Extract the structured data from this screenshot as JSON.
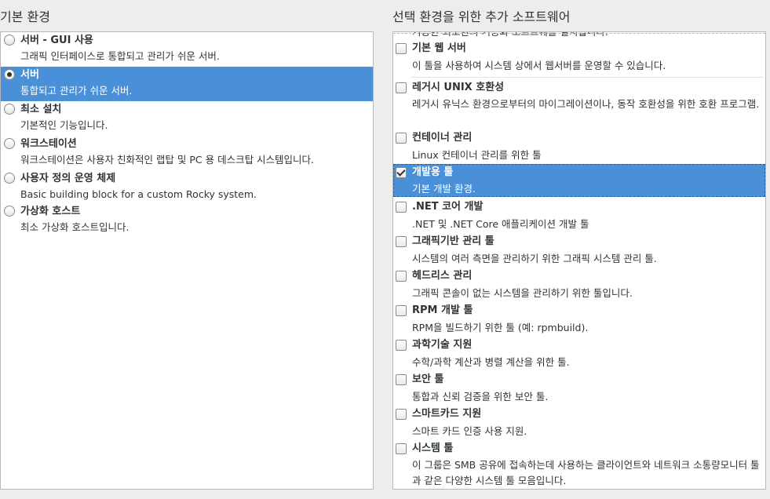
{
  "left": {
    "title": "기본 환경",
    "items": [
      {
        "title": "서버 - GUI 사용",
        "desc": "그래픽 인터페이스로 통합되고 관리가 쉬운 서버.",
        "selected": false
      },
      {
        "title": "서버",
        "desc": "통합되고 관리가 쉬운 서버.",
        "selected": true
      },
      {
        "title": "최소 설치",
        "desc": "기본적인 기능입니다.",
        "selected": false
      },
      {
        "title": "워크스테이션",
        "desc": "워크스테이션은 사용자 친화적인 랩탑 및 PC 용 데스크탑 시스템입니다.",
        "selected": false
      },
      {
        "title": "사용자 정의 운영 체제",
        "desc": "Basic building block for a custom Rocky system.",
        "selected": false
      },
      {
        "title": "가상화 호스트",
        "desc": "최소 가상화 호스트입니다.",
        "selected": false
      }
    ]
  },
  "right": {
    "title": "선택 환경을 위한 추가 소프트웨어",
    "clipped_text": "기능한 최소한의 기능화 소프트웨를 설치합니다.",
    "items": [
      {
        "title": "기본 웹 서버",
        "desc": "이 툴을 사용하여 시스템 상에서 웹서버를 운영할 수 있습니다.",
        "checked": false
      },
      {
        "title": "레거시 UNIX 호환성",
        "desc": "레거시 유닉스 환경으로부터의 마이그레이션이나, 동작 호환성을 위한 호환 프로그램.",
        "checked": false
      },
      {
        "title": "컨테이너 관리",
        "desc": "Linux 컨테이너 관리를 위한 툴",
        "checked": false
      },
      {
        "title": "개발용 툴",
        "desc": "기본 개발 환경.",
        "checked": true
      },
      {
        "title": ".NET 코어 개발",
        "desc": ".NET 및 .NET Core 애플리케이션 개발 툴",
        "checked": false
      },
      {
        "title": "그래픽기반 관리 툴",
        "desc": "시스템의 여러 측면을 관리하기 위한 그래픽 시스템 관리 툴.",
        "checked": false
      },
      {
        "title": "헤드리스 관리",
        "desc": "그래픽 콘솔이 없는 시스템을 관리하기 위한 툴입니다.",
        "checked": false
      },
      {
        "title": "RPM 개발 툴",
        "desc": "RPM을 빌드하기 위한 툴 (예: rpmbuild).",
        "checked": false
      },
      {
        "title": "과학기술 지원",
        "desc": "수학/과학 계산과 병렬 계산을 위한 툴.",
        "checked": false
      },
      {
        "title": "보안 툴",
        "desc": "통합과 신뢰 검증을 위한 보안 툴.",
        "checked": false
      },
      {
        "title": "스마트카드 지원",
        "desc": "스마트 카드 인증 사용 지원.",
        "checked": false
      },
      {
        "title": "시스템 툴",
        "desc": "이 그룹은 SMB 공유에 접속하는데 사용하는 클라이언트와 네트워크 소통량모니터 툴과 같은 다양한 시스템 툴 모음입니다.",
        "checked": false
      }
    ]
  },
  "colors": {
    "selection": "#4a90d9",
    "panel_bg": "#ffffff",
    "window_bg": "#ededed"
  }
}
